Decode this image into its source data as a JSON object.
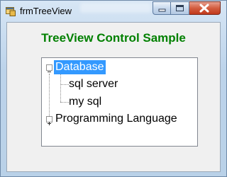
{
  "window": {
    "title": "frmTreeView"
  },
  "heading": "TreeView Control Sample",
  "colors": {
    "heading": "#008000",
    "selection": "#3399ff",
    "close_button": "#c94a2e"
  },
  "tree": {
    "nodes": [
      {
        "label": "Database",
        "expanded": true,
        "selected": true,
        "children": [
          {
            "label": "sql server"
          },
          {
            "label": "my sql"
          }
        ]
      },
      {
        "label": "Programming Language",
        "expanded": false,
        "selected": false
      }
    ]
  },
  "icons": {
    "app": "app-form-icon",
    "minimize": "minimize-icon",
    "maximize": "maximize-icon",
    "close": "close-icon",
    "collapse": "minus-box-icon",
    "expand": "plus-box-icon"
  }
}
